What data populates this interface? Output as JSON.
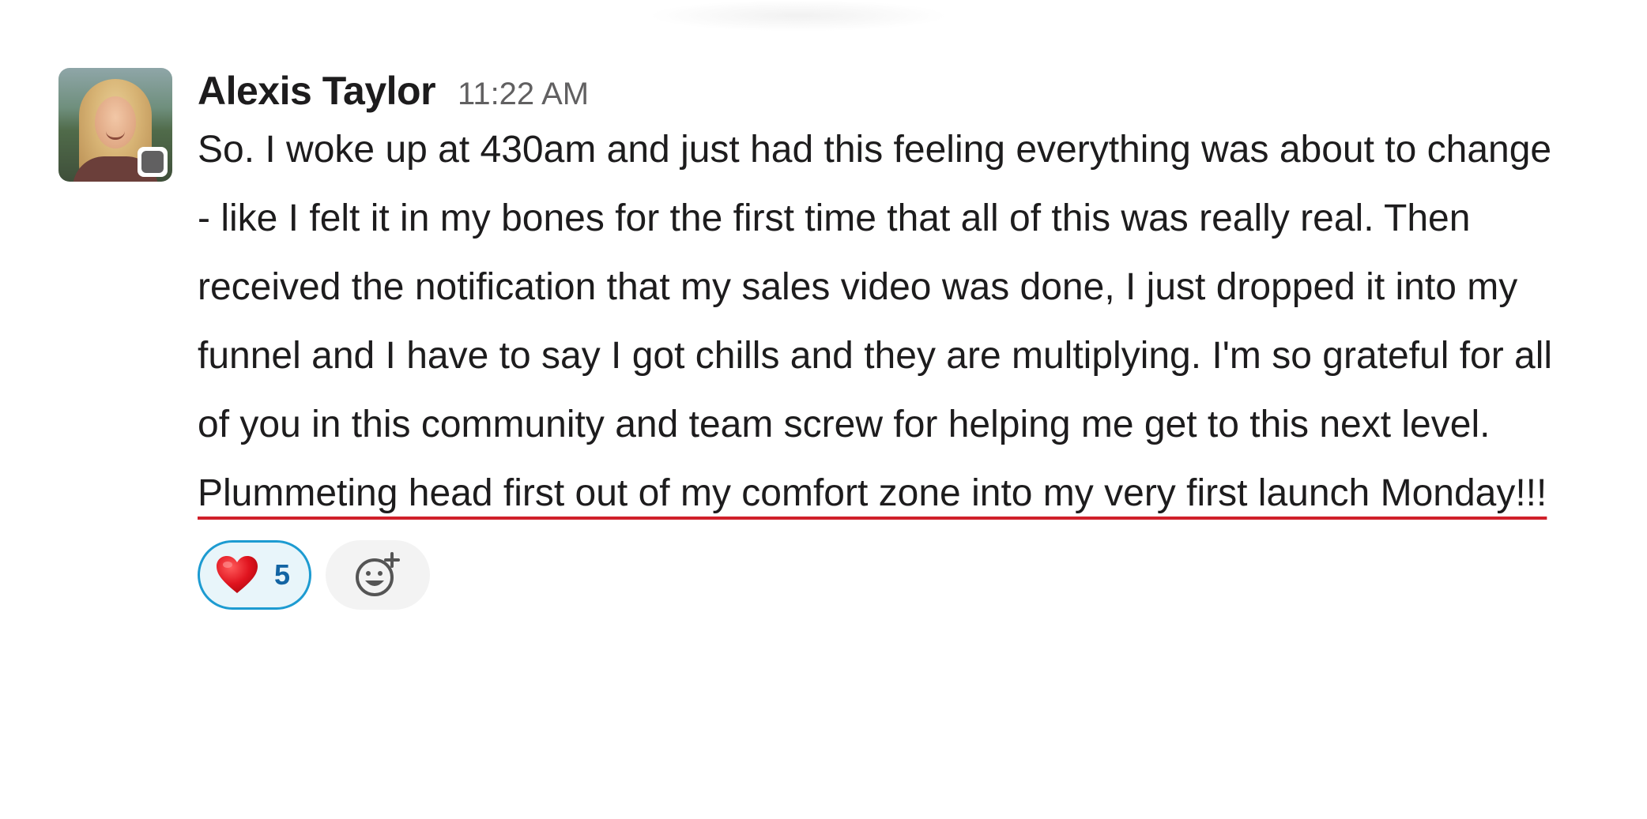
{
  "message": {
    "author": "Alexis Taylor",
    "timestamp": "11:22 AM",
    "body_plain": "So. I woke up at 430am and just had this feeling everything was about to change - like I felt it in my bones for the first time that all of this was really real. Then received the notification that my sales video was done, I just dropped it into my funnel and I have to say I got chills and they are multiplying. I'm so grateful for all of you in this community and team screw for helping me get to this next level. ",
    "body_underlined": "Plummeting head first out of my comfort zone into my very first launch Monday!!!",
    "avatar_icon": "user-avatar-photo",
    "status_icon": "presence-away-dot"
  },
  "reactions": [
    {
      "emoji": "heart-icon",
      "count": "5",
      "selected": true
    }
  ],
  "add_reaction_icon": "add-reaction-icon",
  "colors": {
    "underline": "#d0202a",
    "reaction_border": "#1d9bd1",
    "reaction_bg": "#e8f5fa",
    "reaction_count": "#1264a3",
    "timestamp": "#616061"
  }
}
